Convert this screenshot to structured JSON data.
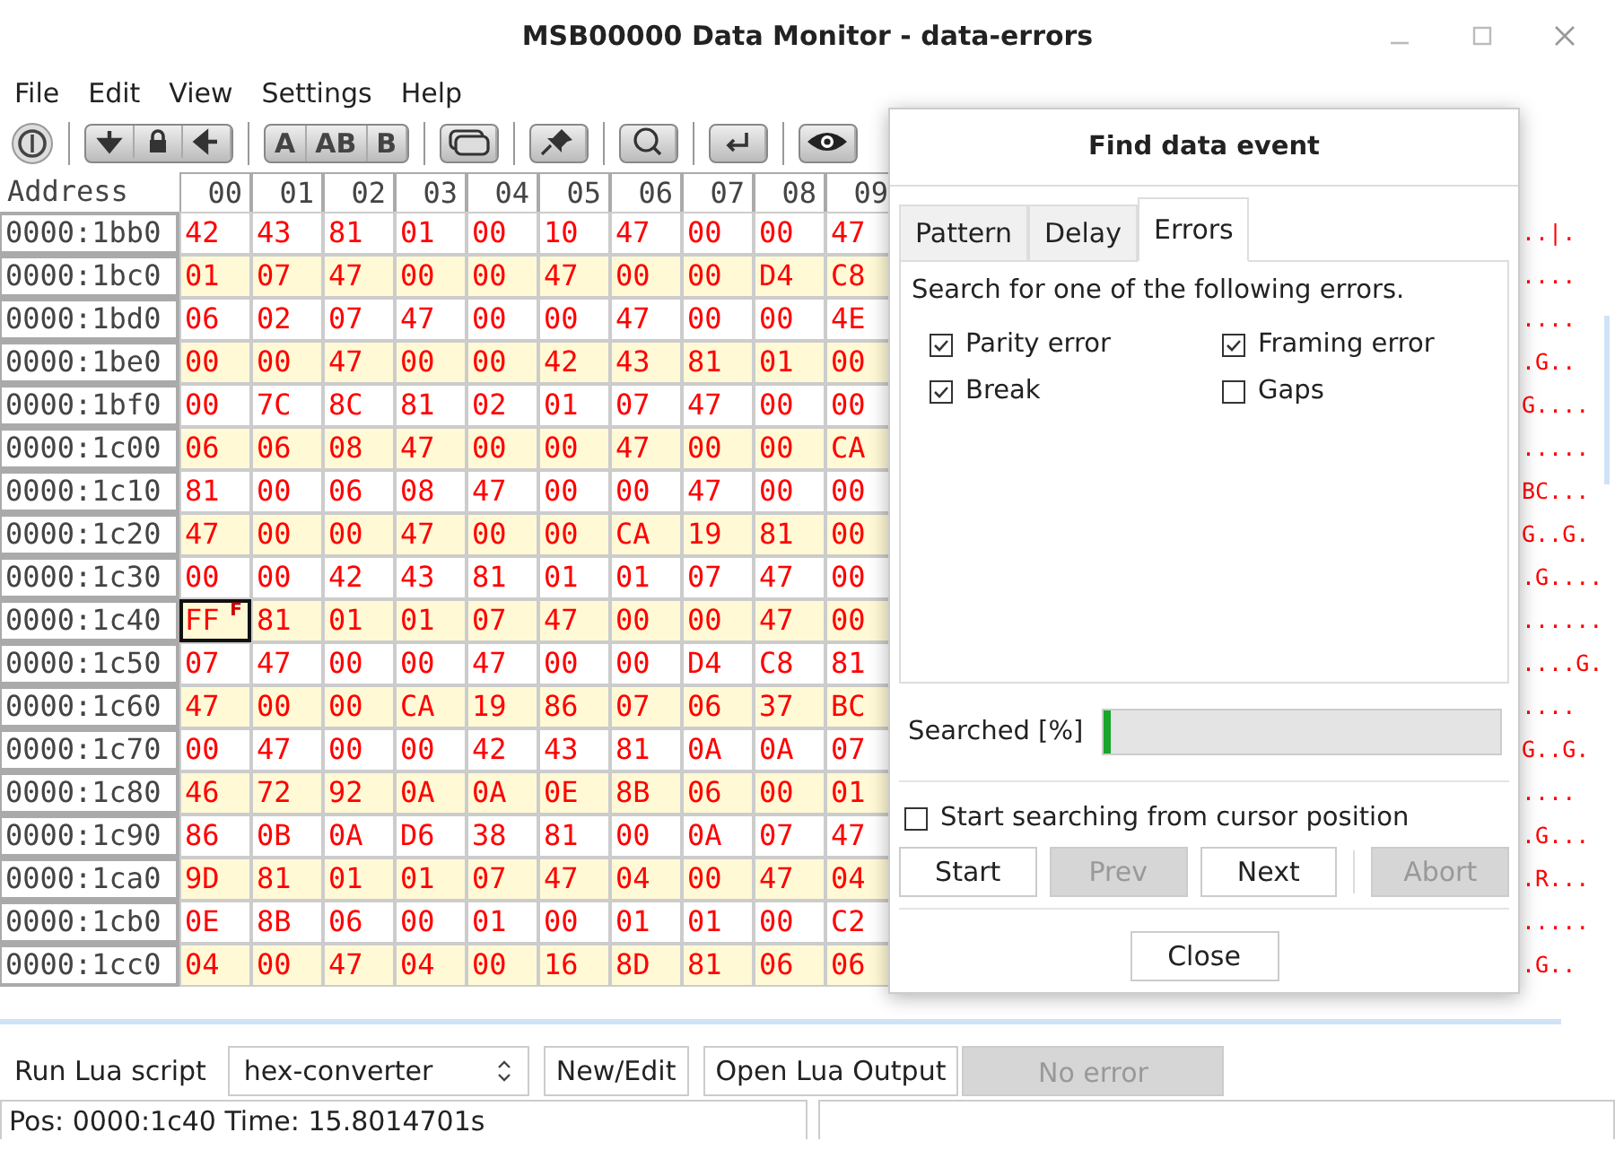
{
  "window": {
    "title": "MSB00000 Data Monitor - data-errors"
  },
  "menu": [
    "File",
    "Edit",
    "View",
    "Settings",
    "Help"
  ],
  "toolbar": {
    "letter_buttons": [
      "A",
      "AB",
      "B"
    ]
  },
  "hex": {
    "address_header": "Address",
    "columns": [
      "00",
      "01",
      "02",
      "03",
      "04",
      "05",
      "06",
      "07",
      "08",
      "09"
    ],
    "rows": [
      {
        "address": "0000:1bb0",
        "bytes": [
          "42",
          "43",
          "81",
          "01",
          "00",
          "10",
          "47",
          "00",
          "00",
          "47"
        ],
        "ascii": "..|.",
        "cursor": false
      },
      {
        "address": "0000:1bc0",
        "bytes": [
          "01",
          "07",
          "47",
          "00",
          "00",
          "47",
          "00",
          "00",
          "D4",
          "C8"
        ],
        "ascii": "....",
        "cursor": false
      },
      {
        "address": "0000:1bd0",
        "bytes": [
          "06",
          "02",
          "07",
          "47",
          "00",
          "00",
          "47",
          "00",
          "00",
          "4E"
        ],
        "ascii": "....",
        "cursor": false
      },
      {
        "address": "0000:1be0",
        "bytes": [
          "00",
          "00",
          "47",
          "00",
          "00",
          "42",
          "43",
          "81",
          "01",
          "00"
        ],
        "ascii": ".G..",
        "cursor": false
      },
      {
        "address": "0000:1bf0",
        "bytes": [
          "00",
          "7C",
          "8C",
          "81",
          "02",
          "01",
          "07",
          "47",
          "00",
          "00"
        ],
        "ascii": "G....",
        "cursor": false
      },
      {
        "address": "0000:1c00",
        "bytes": [
          "06",
          "06",
          "08",
          "47",
          "00",
          "00",
          "47",
          "00",
          "00",
          "CA"
        ],
        "ascii": ".....",
        "cursor": false
      },
      {
        "address": "0000:1c10",
        "bytes": [
          "81",
          "00",
          "06",
          "08",
          "47",
          "00",
          "00",
          "47",
          "00",
          "00"
        ],
        "ascii": "BC...",
        "cursor": false
      },
      {
        "address": "0000:1c20",
        "bytes": [
          "47",
          "00",
          "00",
          "47",
          "00",
          "00",
          "CA",
          "19",
          "81",
          "00"
        ],
        "ascii": "G..G.",
        "cursor": false
      },
      {
        "address": "0000:1c30",
        "bytes": [
          "00",
          "00",
          "42",
          "43",
          "81",
          "01",
          "01",
          "07",
          "47",
          "00"
        ],
        "ascii": ".G....",
        "cursor": false
      },
      {
        "address": "0000:1c40",
        "bytes": [
          "FF",
          "81",
          "01",
          "01",
          "07",
          "47",
          "00",
          "00",
          "47",
          "00"
        ],
        "ascii": "......",
        "cursor": true,
        "flag": "F"
      },
      {
        "address": "0000:1c50",
        "bytes": [
          "07",
          "47",
          "00",
          "00",
          "47",
          "00",
          "00",
          "D4",
          "C8",
          "81"
        ],
        "ascii": "....G.",
        "cursor": false
      },
      {
        "address": "0000:1c60",
        "bytes": [
          "47",
          "00",
          "00",
          "CA",
          "19",
          "86",
          "07",
          "06",
          "37",
          "BC"
        ],
        "ascii": "....",
        "cursor": false
      },
      {
        "address": "0000:1c70",
        "bytes": [
          "00",
          "47",
          "00",
          "00",
          "42",
          "43",
          "81",
          "0A",
          "0A",
          "07"
        ],
        "ascii": "G..G.",
        "cursor": false
      },
      {
        "address": "0000:1c80",
        "bytes": [
          "46",
          "72",
          "92",
          "0A",
          "0A",
          "0E",
          "8B",
          "06",
          "00",
          "01"
        ],
        "ascii": "....",
        "cursor": false
      },
      {
        "address": "0000:1c90",
        "bytes": [
          "86",
          "0B",
          "0A",
          "D6",
          "38",
          "81",
          "00",
          "0A",
          "07",
          "47"
        ],
        "ascii": ".G...",
        "cursor": false
      },
      {
        "address": "0000:1ca0",
        "bytes": [
          "9D",
          "81",
          "01",
          "01",
          "07",
          "47",
          "04",
          "00",
          "47",
          "04"
        ],
        "ascii": ".R...",
        "cursor": false
      },
      {
        "address": "0000:1cb0",
        "bytes": [
          "0E",
          "8B",
          "06",
          "00",
          "01",
          "00",
          "01",
          "01",
          "00",
          "C2"
        ],
        "ascii": ".....",
        "cursor": false
      },
      {
        "address": "0000:1cc0",
        "bytes": [
          "04",
          "00",
          "47",
          "04",
          "00",
          "16",
          "8D",
          "81",
          "06",
          "06"
        ],
        "ascii": ".G..",
        "cursor": false
      }
    ]
  },
  "dialog": {
    "title": "Find data event",
    "tabs": [
      {
        "label": "Pattern",
        "selected": false
      },
      {
        "label": "Delay",
        "selected": false
      },
      {
        "label": "Errors",
        "selected": true
      }
    ],
    "description": "Search for one of the following errors.",
    "options": [
      {
        "label": "Parity error",
        "checked": true
      },
      {
        "label": "Framing error",
        "checked": true
      },
      {
        "label": "Break",
        "checked": true
      },
      {
        "label": "Gaps",
        "checked": false
      }
    ],
    "progress": {
      "label": "Searched [%]",
      "level": 0.02
    },
    "start_from_cursor": {
      "label": "Start searching from cursor position",
      "checked": false
    },
    "buttons": [
      {
        "label": "Start",
        "disabled": false
      },
      {
        "label": "Prev",
        "disabled": true
      },
      {
        "label": "Next",
        "disabled": false
      },
      {
        "label": "Abort",
        "disabled": true
      }
    ],
    "close": "Close"
  },
  "lua": {
    "label": "Run Lua script",
    "script": "hex-converter",
    "buttons": [
      "New/Edit",
      "Open Lua Output"
    ],
    "status": {
      "text": "No error",
      "disabled": true
    }
  },
  "status_bar": {
    "text": "Pos: 0000:1c40 Time: 15.8014701s"
  }
}
